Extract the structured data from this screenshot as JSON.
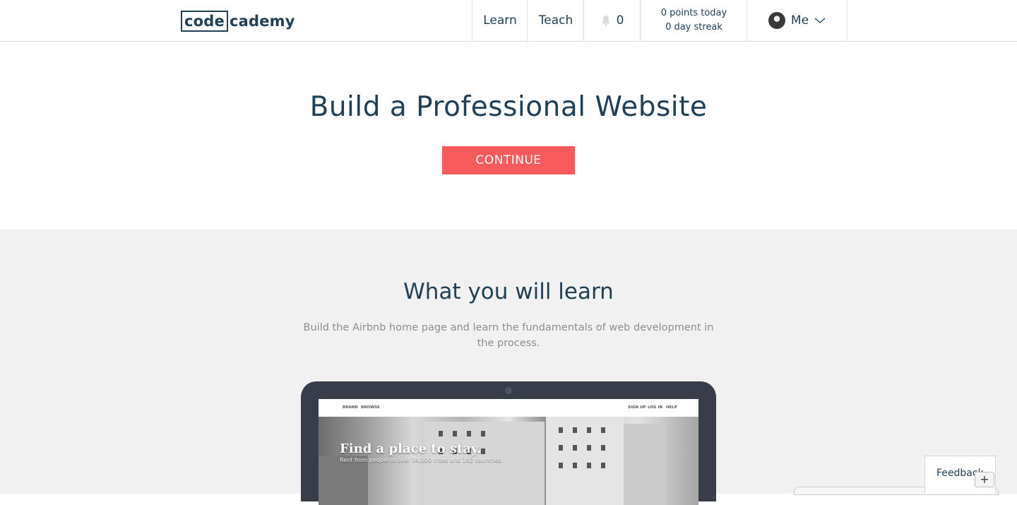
{
  "header": {
    "logo_box": "code",
    "logo_rest": "cademy",
    "nav_learn": "Learn",
    "nav_teach": "Teach",
    "notifications_count": "0",
    "points_today": "0 points today",
    "day_streak": "0 day streak",
    "user_label": "Me"
  },
  "hero": {
    "title": "Build a Professional Website",
    "cta_label": "CONTINUE"
  },
  "learn": {
    "heading": "What you will learn",
    "description": "Build the Airbnb home page and learn the fundamentals of web development in the process."
  },
  "preview": {
    "nav_left": [
      "BRAND",
      "BROWSE"
    ],
    "nav_right": [
      "SIGN UP",
      "LOG IN",
      "HELP"
    ],
    "headline": "Find a place to stay.",
    "subline": "Rent from people in over 34,000 cities and 192 countries."
  },
  "feedback": {
    "label": "Feedback",
    "plus_label": "+"
  },
  "colors": {
    "brand_navy": "#204056",
    "cta_red": "#f65a5b",
    "section_gray": "#f0f1f0",
    "laptop_frame": "#383d49"
  },
  "icons": {
    "notifications": "bell-icon",
    "user_avatar": "avatar",
    "dropdown": "chevron-down-icon"
  }
}
